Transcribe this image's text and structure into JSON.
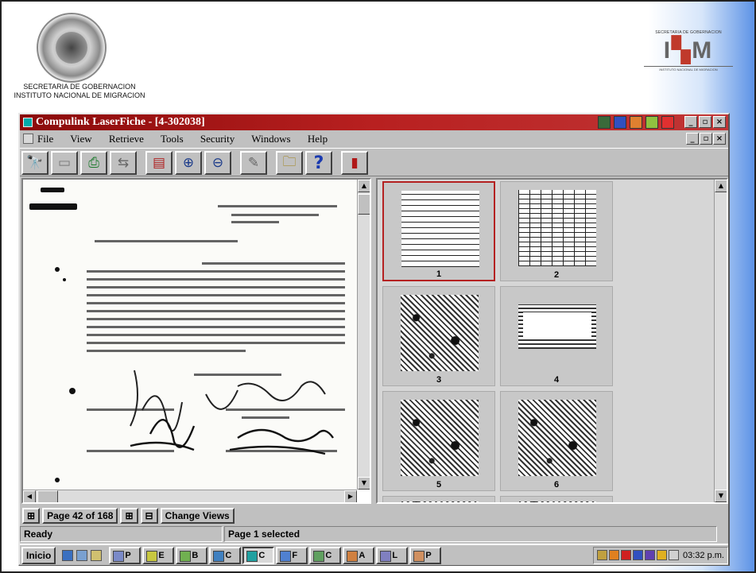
{
  "header": {
    "left_caption_line1": "SECRETARIA DE GOBERNACION",
    "left_caption_line2": "INSTITUTO NACIONAL DE MIGRACION",
    "inm_top": "SECRETARIA DE GOBERNACION",
    "inm_logo": "INM",
    "inm_bottom": "INSTITUTO NACIONAL DE MIGRACION"
  },
  "window": {
    "title": "Compulink LaserFiche - [4-302038]",
    "menu": [
      "File",
      "View",
      "Retrieve",
      "Tools",
      "Security",
      "Windows",
      "Help"
    ],
    "title_buttons": [
      "_",
      "▫",
      "×"
    ],
    "mdi_buttons": [
      "_",
      "▫",
      "×"
    ]
  },
  "toolbar": {
    "icons": [
      "binoculars-icon",
      "scanner-icon",
      "print-icon",
      "transfer-icon",
      "page-view-icon",
      "zoom-in-icon",
      "zoom-out-icon",
      "pencil-icon",
      "folders-icon",
      "help-icon",
      "book-icon"
    ],
    "glyphs": [
      "🔭",
      "▭",
      "⎙",
      "⇆",
      "▤",
      "⊕",
      "⊖",
      "✎",
      "🗀",
      "?",
      "▮"
    ]
  },
  "thumbnails": [
    {
      "number": "1",
      "style": "grid-doc",
      "selected": true
    },
    {
      "number": "2",
      "style": "grid2-doc",
      "selected": false
    },
    {
      "number": "3",
      "style": "noisy",
      "selected": false
    },
    {
      "number": "4",
      "style": "stamp",
      "selected": false
    },
    {
      "number": "5",
      "style": "noisy",
      "selected": false
    },
    {
      "number": "6",
      "style": "noisy",
      "selected": false
    }
  ],
  "nav": {
    "prev_glyph": "⊞",
    "page_label": "Page 42 of 168",
    "next_glyph": "⊞",
    "view_glyph": "⊟",
    "change_views": "Change Views"
  },
  "status": {
    "left": "Ready",
    "right": "Page 1 selected"
  },
  "taskbar": {
    "start": "Inicio",
    "tasks": [
      {
        "label": "P",
        "color": "#7a8ac8"
      },
      {
        "label": "E",
        "color": "#c8c840"
      },
      {
        "label": "B",
        "color": "#70b050"
      },
      {
        "label": "C",
        "color": "#4080c0"
      },
      {
        "label": "C",
        "color": "#20a0a0",
        "active": true
      },
      {
        "label": "F",
        "color": "#5080d0"
      },
      {
        "label": "C",
        "color": "#60a060"
      },
      {
        "label": "A",
        "color": "#d08040"
      },
      {
        "label": "L",
        "color": "#8080c0"
      },
      {
        "label": "P",
        "color": "#d09060"
      }
    ],
    "clock": "03:32 p.m."
  }
}
